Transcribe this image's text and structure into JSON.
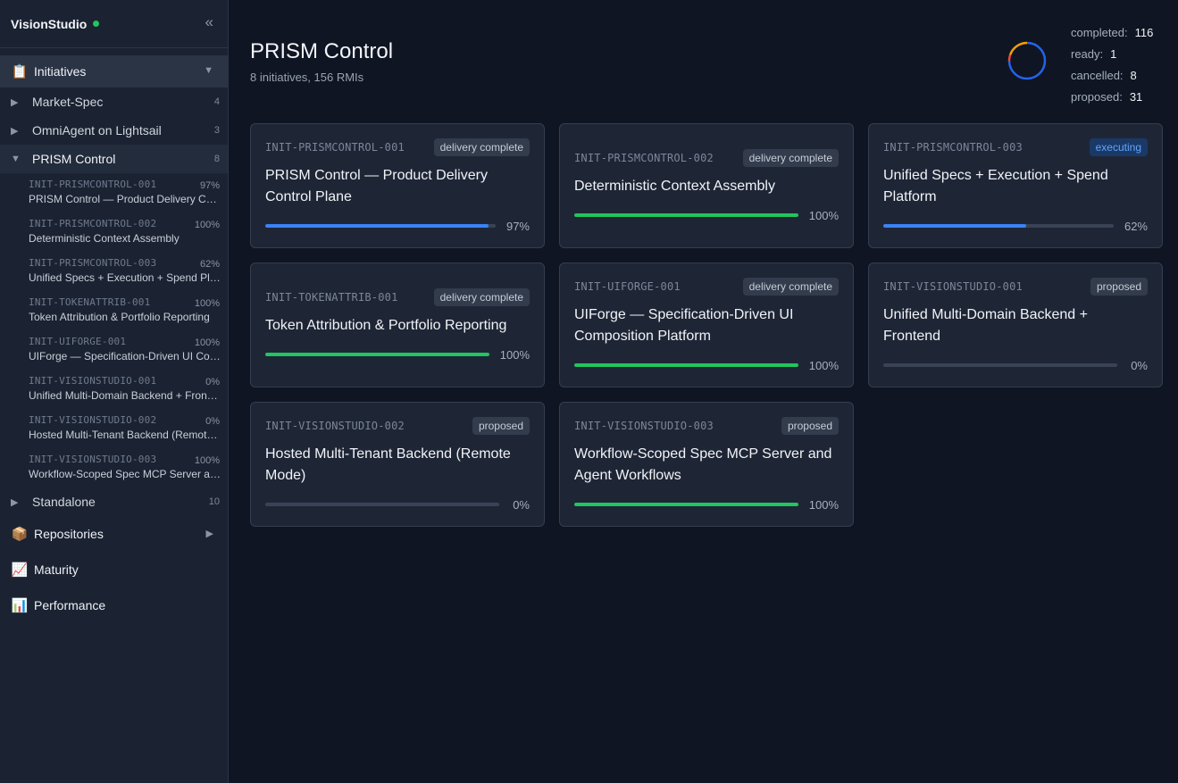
{
  "app": {
    "name": "VisionStudio",
    "status_color": "#22c55e"
  },
  "sidebar": {
    "collapse_icon": "«",
    "sections": [
      {
        "id": "initiatives",
        "emoji": "📋",
        "label": "Initiatives",
        "caret": "▼"
      },
      {
        "id": "repositories",
        "emoji": "📦",
        "label": "Repositories",
        "caret": "▶"
      },
      {
        "id": "maturity",
        "emoji": "📈",
        "label": "Maturity"
      },
      {
        "id": "performance",
        "emoji": "📊",
        "label": "Performance"
      }
    ],
    "groups": [
      {
        "label": "Market-Spec",
        "count": "4",
        "caret": "▶",
        "expanded": false
      },
      {
        "label": "OmniAgent on Lightsail",
        "count": "3",
        "caret": "▶",
        "expanded": false
      },
      {
        "label": "PRISM Control",
        "count": "8",
        "caret": "▼",
        "expanded": true,
        "items": [
          {
            "id": "INIT-PRISMCONTROL-001",
            "pct": "97%",
            "title": "PRISM Control — Product Delivery Control Plane"
          },
          {
            "id": "INIT-PRISMCONTROL-002",
            "pct": "100%",
            "title": "Deterministic Context Assembly"
          },
          {
            "id": "INIT-PRISMCONTROL-003",
            "pct": "62%",
            "title": "Unified Specs + Execution + Spend Platform"
          },
          {
            "id": "INIT-TOKENATTRIB-001",
            "pct": "100%",
            "title": "Token Attribution & Portfolio Reporting"
          },
          {
            "id": "INIT-UIFORGE-001",
            "pct": "100%",
            "title": "UIForge — Specification-Driven UI Composition Platform"
          },
          {
            "id": "INIT-VISIONSTUDIO-001",
            "pct": "0%",
            "title": "Unified Multi-Domain Backend + Frontend"
          },
          {
            "id": "INIT-VISIONSTUDIO-002",
            "pct": "0%",
            "title": "Hosted Multi-Tenant Backend (Remote Mode)"
          },
          {
            "id": "INIT-VISIONSTUDIO-003",
            "pct": "100%",
            "title": "Workflow-Scoped Spec MCP Server and Agent Workflows"
          }
        ]
      },
      {
        "label": "Standalone",
        "count": "10",
        "caret": "▶",
        "expanded": false
      }
    ]
  },
  "main": {
    "title": "PRISM Control",
    "subtitle": "8 initiatives, 156 RMIs",
    "stats": [
      {
        "label": "completed:",
        "value": "116",
        "count": 116,
        "color": "#2563eb"
      },
      {
        "label": "ready:",
        "value": "1",
        "count": 1,
        "color": "#22c55e"
      },
      {
        "label": "cancelled:",
        "value": "8",
        "count": 8,
        "color": "#ef4444"
      },
      {
        "label": "proposed:",
        "value": "31",
        "count": 31,
        "color": "#f59e0b"
      }
    ],
    "cards": [
      {
        "id": "INIT-PRISMCONTROL-001",
        "badge": "delivery complete",
        "badge_kind": "default",
        "title": "PRISM Control — Product Delivery Control Plane",
        "progress": 0.97,
        "pct": "97%",
        "bar_color": "#3b82f6"
      },
      {
        "id": "INIT-PRISMCONTROL-002",
        "badge": "delivery complete",
        "badge_kind": "default",
        "title": "Deterministic Context Assembly",
        "progress": 1.0,
        "pct": "100%",
        "bar_color": "#22c55e"
      },
      {
        "id": "INIT-PRISMCONTROL-003",
        "badge": "executing",
        "badge_kind": "exec",
        "title": "Unified Specs + Execution + Spend Platform",
        "progress": 0.62,
        "pct": "62%",
        "bar_color": "#3b82f6"
      },
      {
        "id": "INIT-TOKENATTRIB-001",
        "badge": "delivery complete",
        "badge_kind": "default",
        "title": "Token Attribution & Portfolio Reporting",
        "progress": 1.0,
        "pct": "100%",
        "bar_color": "#22c55e"
      },
      {
        "id": "INIT-UIFORGE-001",
        "badge": "delivery complete",
        "badge_kind": "default",
        "title": "UIForge — Specification-Driven UI Composition Platform",
        "progress": 1.0,
        "pct": "100%",
        "bar_color": "#22c55e"
      },
      {
        "id": "INIT-VISIONSTUDIO-001",
        "badge": "proposed",
        "badge_kind": "default",
        "title": "Unified Multi-Domain Backend + Frontend",
        "progress": 0.0,
        "pct": "0%",
        "bar_color": "#3b82f6"
      },
      {
        "id": "INIT-VISIONSTUDIO-002",
        "badge": "proposed",
        "badge_kind": "default",
        "title": "Hosted Multi-Tenant Backend (Remote Mode)",
        "progress": 0.0,
        "pct": "0%",
        "bar_color": "#3b82f6"
      },
      {
        "id": "INIT-VISIONSTUDIO-003",
        "badge": "proposed",
        "badge_kind": "default",
        "title": "Workflow-Scoped Spec MCP Server and Agent Workflows",
        "progress": 1.0,
        "pct": "100%",
        "bar_color": "#22c55e"
      }
    ]
  }
}
